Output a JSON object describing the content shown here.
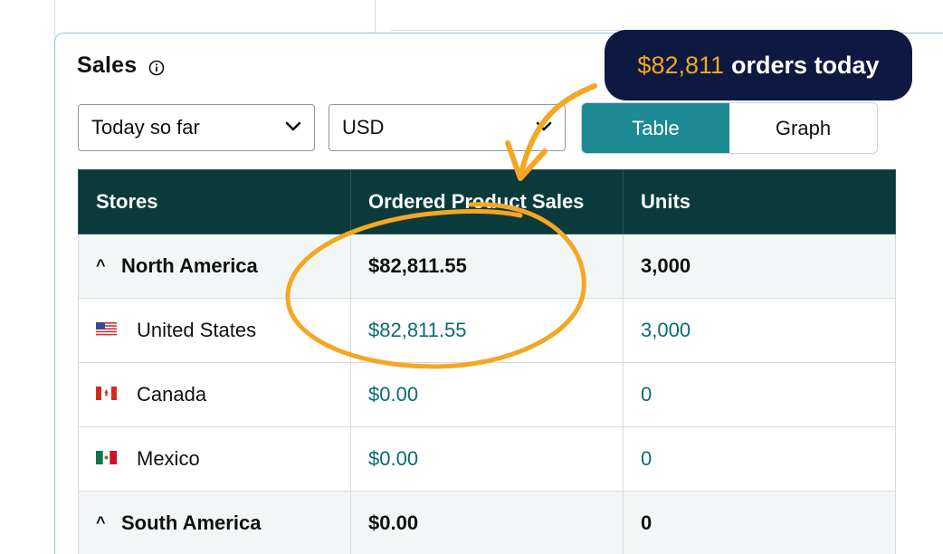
{
  "card": {
    "title": "Sales",
    "period_select": {
      "value": "Today so far"
    },
    "currency_select": {
      "value": "USD"
    },
    "view_toggle": {
      "table_label": "Table",
      "graph_label": "Graph",
      "active": "Table"
    }
  },
  "table": {
    "headers": [
      "Stores",
      "Ordered Product Sales",
      "Units"
    ],
    "rows": [
      {
        "type": "region",
        "name": "North America",
        "sales": "$82,811.55",
        "units": "3,000"
      },
      {
        "type": "country",
        "flag": "us-flag-icon",
        "name": "United States",
        "sales": "$82,811.55",
        "units": "3,000"
      },
      {
        "type": "country",
        "flag": "canada-flag-icon",
        "name": "Canada",
        "sales": "$0.00",
        "units": "0"
      },
      {
        "type": "country",
        "flag": "mexico-flag-icon",
        "name": "Mexico",
        "sales": "$0.00",
        "units": "0"
      },
      {
        "type": "region",
        "name": "South America",
        "sales": "$0.00",
        "units": "0"
      }
    ]
  },
  "callout": {
    "amount": "$82,811",
    "text": "orders today"
  },
  "colors": {
    "header_bg": "#0b3a3c",
    "toggle_active": "#1e8a94",
    "link_value": "#0b6b73",
    "annotation_orange": "#f5a623",
    "callout_bg": "#0d1940"
  }
}
